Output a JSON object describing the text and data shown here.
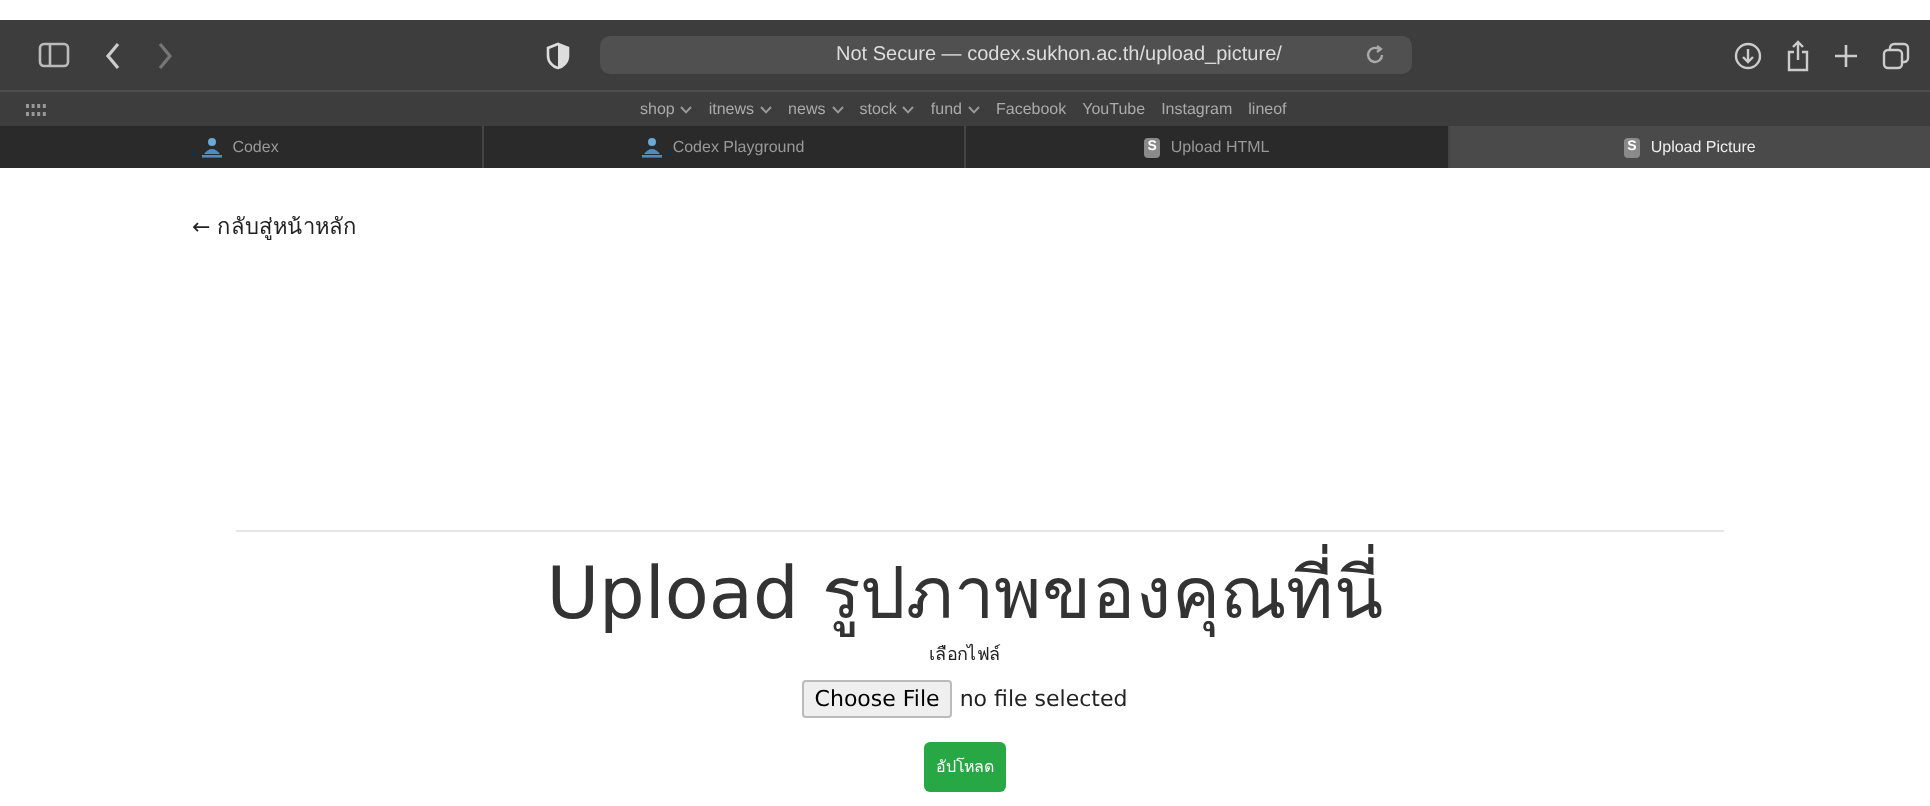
{
  "browser": {
    "address": "Not Secure — codex.sukhon.ac.th/upload_picture/",
    "bookmarks": [
      {
        "label": "shop",
        "kind": "folder"
      },
      {
        "label": "itnews",
        "kind": "folder"
      },
      {
        "label": "news",
        "kind": "folder"
      },
      {
        "label": "stock",
        "kind": "folder"
      },
      {
        "label": "fund",
        "kind": "folder"
      },
      {
        "label": "Facebook",
        "kind": "link"
      },
      {
        "label": "YouTube",
        "kind": "link"
      },
      {
        "label": "Instagram",
        "kind": "link"
      },
      {
        "label": "lineof",
        "kind": "link"
      }
    ],
    "tabs": [
      {
        "label": "Codex",
        "kind": "figure",
        "selected": false
      },
      {
        "label": "Codex Playground",
        "kind": "figure",
        "selected": false
      },
      {
        "label": "Upload HTML",
        "kind": "letter",
        "icon_text": "S",
        "selected": false
      },
      {
        "label": "Upload Picture",
        "kind": "letter",
        "icon_text": "S",
        "selected": true
      }
    ]
  },
  "page": {
    "back_link": "← กลับสู่หน้าหลัก",
    "heading": "Upload รูปภาพของคุณที่นี่",
    "file_label": "เลือกไฟล์",
    "file_button": "Choose File",
    "file_status": "no file selected",
    "submit": "อัปโหลด"
  }
}
